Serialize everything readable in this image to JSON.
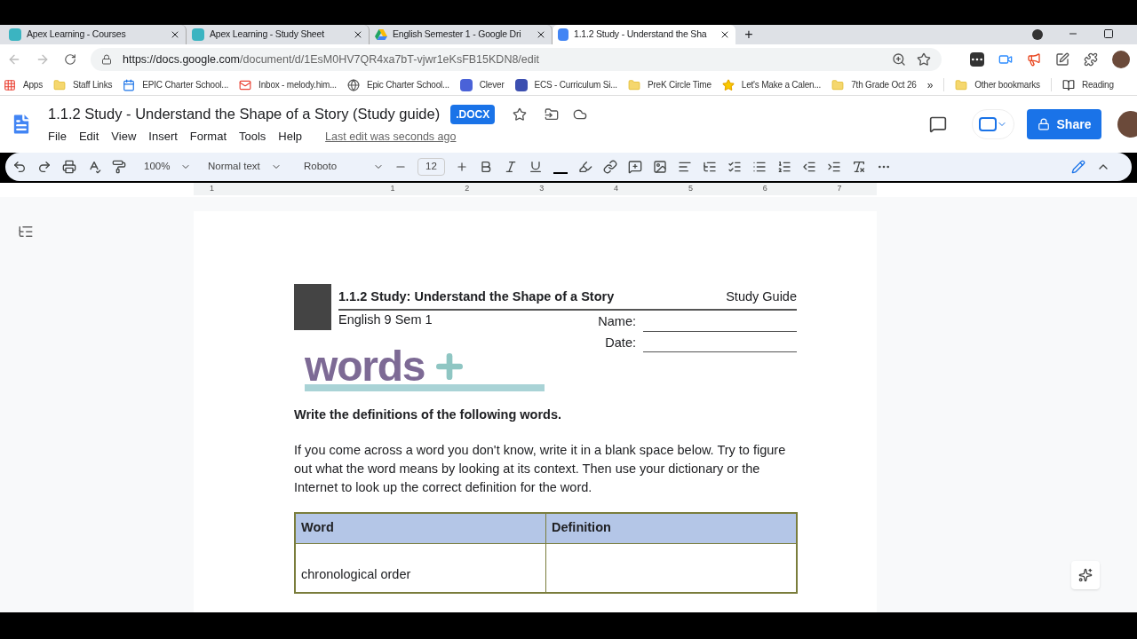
{
  "tabs": [
    {
      "label": "Apex Learning - Courses",
      "selected": false,
      "kind": "apex"
    },
    {
      "label": "Apex Learning - Study Sheet",
      "selected": false,
      "kind": "apex"
    },
    {
      "label": "English Semester 1 - Google Dri",
      "selected": false,
      "kind": "drive"
    },
    {
      "label": "1.1.2 Study - Understand the Sha",
      "selected": true,
      "kind": "docs"
    }
  ],
  "new_tab": "+",
  "address": {
    "host": "https://docs.google.com",
    "path": "/document/d/1EsM0HV7QR4xa7bT-vjwr1eKsFB15KDN8/edit"
  },
  "bookmarks": [
    {
      "label": "Apps",
      "kind": "apps"
    },
    {
      "label": "Staff Links",
      "kind": "folder"
    },
    {
      "label": "EPIC Charter School...",
      "kind": "calendar"
    },
    {
      "label": "Inbox - melody.him...",
      "kind": "mail"
    },
    {
      "label": "Epic Charter School...",
      "kind": "globe"
    },
    {
      "label": "Clever",
      "kind": "clever"
    },
    {
      "label": "ECS - Curriculum Si...",
      "kind": "site"
    },
    {
      "label": "PreK Circle Time",
      "kind": "folder"
    },
    {
      "label": "Let's Make a Calen...",
      "kind": "star"
    },
    {
      "label": "7th Grade Oct 26",
      "kind": "folder"
    }
  ],
  "bookmarks_overflow": "»",
  "other_bookmarks": "Other bookmarks",
  "reading_list": "Reading",
  "doc": {
    "title": "1.1.2 Study - Understand the Shape of a Story (Study guide)",
    "badge": ".DOCX",
    "menus": [
      "File",
      "Edit",
      "View",
      "Insert",
      "Format",
      "Tools",
      "Help"
    ],
    "last_edit": "Last edit was seconds ago",
    "share": "Share"
  },
  "toolbar": {
    "zoom": "100%",
    "style": "Normal text",
    "font": "Roboto",
    "size": "12"
  },
  "ruler": [
    "1",
    "1",
    "2",
    "3",
    "4",
    "5",
    "6",
    "7"
  ],
  "page": {
    "heading": "1.1.2 Study: Understand the Shape of a Story",
    "guide_label": "Study Guide",
    "course": "English 9 Sem 1",
    "name_label": "Name:",
    "date_label": "Date:",
    "logo_text": "words",
    "instruction": "Write the definitions of the following words.",
    "paragraph": "If you come across a word you don't know, write it in a blank space below. Try to figure out what the word means by looking at its context. Then use your dictionary or the Internet to look up the correct definition for the word.",
    "table": {
      "columns": [
        "Word",
        "Definition"
      ],
      "rows": [
        [
          "chronological order",
          ""
        ]
      ]
    }
  }
}
